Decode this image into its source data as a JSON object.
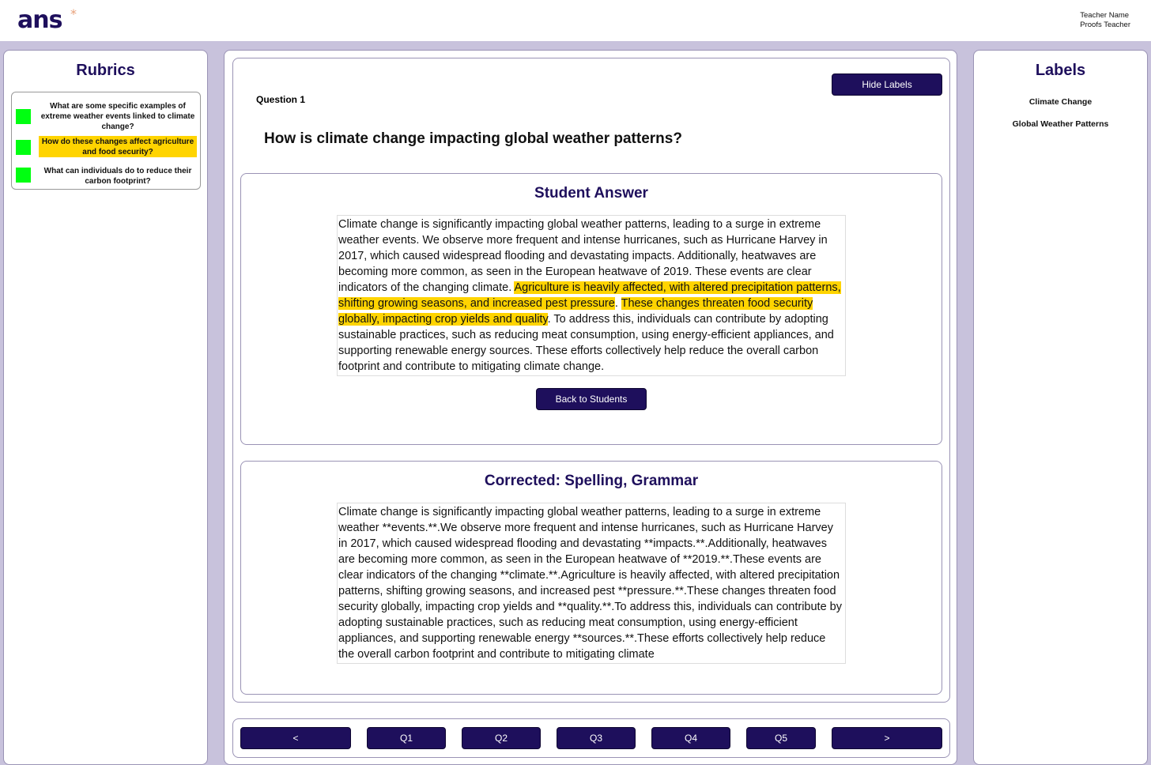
{
  "header": {
    "logo": "ans",
    "logo_mark": "*",
    "teacher_name_label": "Teacher Name",
    "teacher_name": "Proofs Teacher"
  },
  "rubrics": {
    "title": "Rubrics",
    "items": [
      {
        "label": "What are some specific examples of extreme weather events linked to climate change?",
        "status_color": "#00ff11",
        "active": false
      },
      {
        "label": "How do these changes affect agriculture and food security?",
        "status_color": "#00ff11",
        "active": true
      },
      {
        "label": "What can individuals do to reduce their carbon footprint?",
        "status_color": "#00ff11",
        "active": false
      }
    ]
  },
  "labels": {
    "title": "Labels",
    "items": [
      "Climate Change",
      "Global Weather Patterns"
    ]
  },
  "question": {
    "number": "Question 1",
    "text": "How is climate change impacting global weather patterns?",
    "hide_labels_button": "Hide Labels"
  },
  "student_answer": {
    "title": "Student Answer",
    "text_before": "Climate change is significantly impacting global weather patterns, leading to a surge in extreme weather events. We observe more frequent and intense hurricanes, such as Hurricane Harvey in 2017, which caused widespread flooding and devastating impacts. Additionally, heatwaves are becoming more common, as seen in the European heatwave of 2019. These events are clear indicators of the changing climate. ",
    "highlight_1": "Agriculture is heavily affected, with altered precipitation patterns, shifting growing seasons, and increased pest pressure",
    "between": ". ",
    "highlight_2": "These changes threaten food security globally, impacting crop yields and quality",
    "text_after": ". To address this, individuals can contribute by adopting sustainable practices, such as reducing meat consumption, using energy-efficient appliances, and supporting renewable energy sources. These efforts collectively help reduce the overall carbon footprint and contribute to mitigating climate change.",
    "back_button": "Back to Students"
  },
  "corrected": {
    "title": "Corrected: Spelling, Grammar",
    "text": "Climate change is significantly impacting global weather patterns, leading to a surge in extreme weather **events.**.We observe more frequent and intense hurricanes, such as Hurricane Harvey in 2017, which caused widespread flooding and devastating **impacts.**.Additionally, heatwaves are becoming more common, as seen in the European heatwave of **2019.**.These events are clear indicators of the changing **climate.**.Agriculture is heavily affected, with altered precipitation patterns, shifting growing seasons, and increased pest **pressure.**.These changes threaten food security globally, impacting crop yields and **quality.**.To address this, individuals can contribute by adopting sustainable practices, such as reducing meat consumption, using energy-efficient appliances, and supporting renewable energy **sources.**.These efforts collectively help reduce the overall carbon footprint and contribute to mitigating climate"
  },
  "navigation": {
    "prev": "<",
    "next": ">",
    "questions": [
      "Q1",
      "Q2",
      "Q3",
      "Q4",
      "Q5"
    ]
  },
  "colors": {
    "brand": "#1e0f5c",
    "highlight": "#ffd400",
    "status_green": "#00ff11",
    "background": "#c8c2dc"
  }
}
